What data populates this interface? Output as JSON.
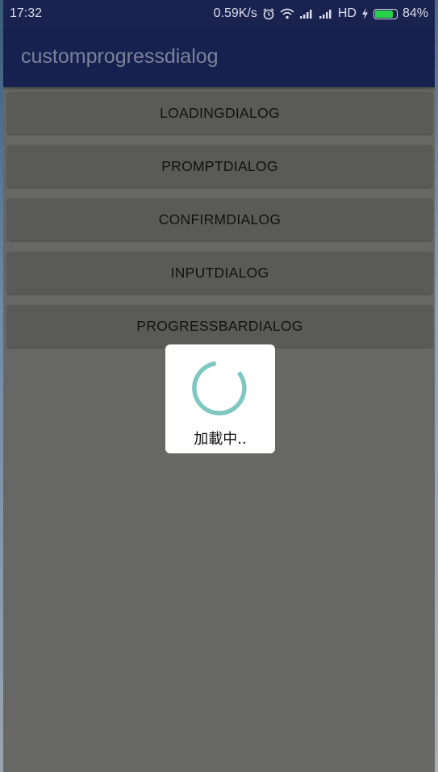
{
  "status_bar": {
    "time": "17:32",
    "speed": "0.59K/s",
    "network_type": "HD",
    "battery_percent": "84%",
    "icons": [
      "alarm-icon",
      "wifi-icon",
      "signal-icon",
      "signal-icon",
      "charging-icon",
      "battery-icon"
    ],
    "battery_level": 0.84
  },
  "app_bar": {
    "title": "customprogressdialog"
  },
  "buttons": [
    {
      "label": "LOADINGDIALOG"
    },
    {
      "label": "PROMPTDIALOG"
    },
    {
      "label": "CONFIRMDIALOG"
    },
    {
      "label": "INPUTDIALOG"
    },
    {
      "label": "PROGRESSBARDIALOG"
    }
  ],
  "dialog": {
    "message": "加載中..",
    "spinner_icon": "loading-spinner-icon"
  },
  "colors": {
    "status_bar": "#1a2250",
    "app_bar": "#172150",
    "title_text": "#7c8299",
    "screen_dim": "#676865",
    "button_bg": "#5a5b59",
    "spinner": "#7fc8c1",
    "battery": "#28d24a"
  }
}
